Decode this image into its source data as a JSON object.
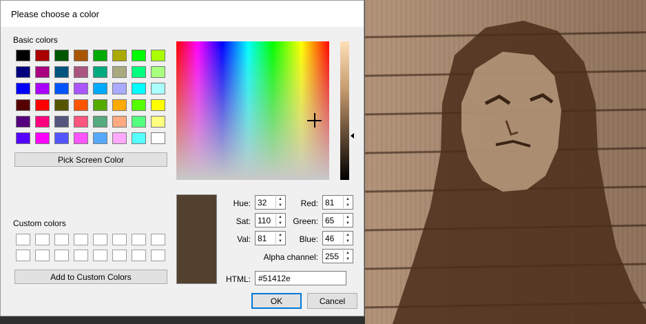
{
  "dialog": {
    "title": "Please choose a color",
    "basic_colors_label": "Basic colors",
    "custom_colors_label": "Custom colors",
    "pick_screen_label": "Pick Screen Color",
    "add_custom_label": "Add to Custom Colors",
    "ok_label": "OK",
    "cancel_label": "Cancel"
  },
  "basic_colors": [
    "#000000",
    "#aa0000",
    "#005500",
    "#aa5500",
    "#00aa00",
    "#aaaa00",
    "#00ff00",
    "#aaff00",
    "#00007f",
    "#aa007f",
    "#00557f",
    "#aa557f",
    "#00aa7f",
    "#aaaa7f",
    "#00ff7f",
    "#aaff7f",
    "#0000ff",
    "#aa00ff",
    "#0055ff",
    "#aa55ff",
    "#00aaff",
    "#aaaaff",
    "#00ffff",
    "#aaffff",
    "#550000",
    "#ff0000",
    "#555500",
    "#ff5500",
    "#55aa00",
    "#ffaa00",
    "#55ff00",
    "#ffff00",
    "#55007f",
    "#ff007f",
    "#55557f",
    "#ff557f",
    "#55aa7f",
    "#ffaa7f",
    "#55ff7f",
    "#ffff7f",
    "#5500ff",
    "#ff00ff",
    "#5555ff",
    "#ff55ff",
    "#55aaff",
    "#ffaaff",
    "#55ffff",
    "#ffffff"
  ],
  "custom_colors": [
    "#ffffff",
    "#ffffff",
    "#ffffff",
    "#ffffff",
    "#ffffff",
    "#ffffff",
    "#ffffff",
    "#ffffff",
    "#ffffff",
    "#ffffff",
    "#ffffff",
    "#ffffff",
    "#ffffff",
    "#ffffff",
    "#ffffff",
    "#ffffff"
  ],
  "current_color": "#51412e",
  "luminance_level": 0.68,
  "fields": {
    "hue_label": "Hue:",
    "hue": "32",
    "sat_label": "Sat:",
    "sat": "110",
    "val_label": "Val:",
    "val": "81",
    "red_label": "Red:",
    "red": "81",
    "green_label": "Green:",
    "green": "65",
    "blue_label": "Blue:",
    "blue": "46",
    "alpha_label": "Alpha channel:",
    "alpha": "255",
    "html_label": "HTML:",
    "html": "#51412e"
  },
  "icons": {
    "spin_up": "spin-up-arrow-icon",
    "spin_down": "spin-down-arrow-icon",
    "crosshair": "crosshair-icon",
    "luminance_pointer": "triangle-pointer-icon"
  }
}
